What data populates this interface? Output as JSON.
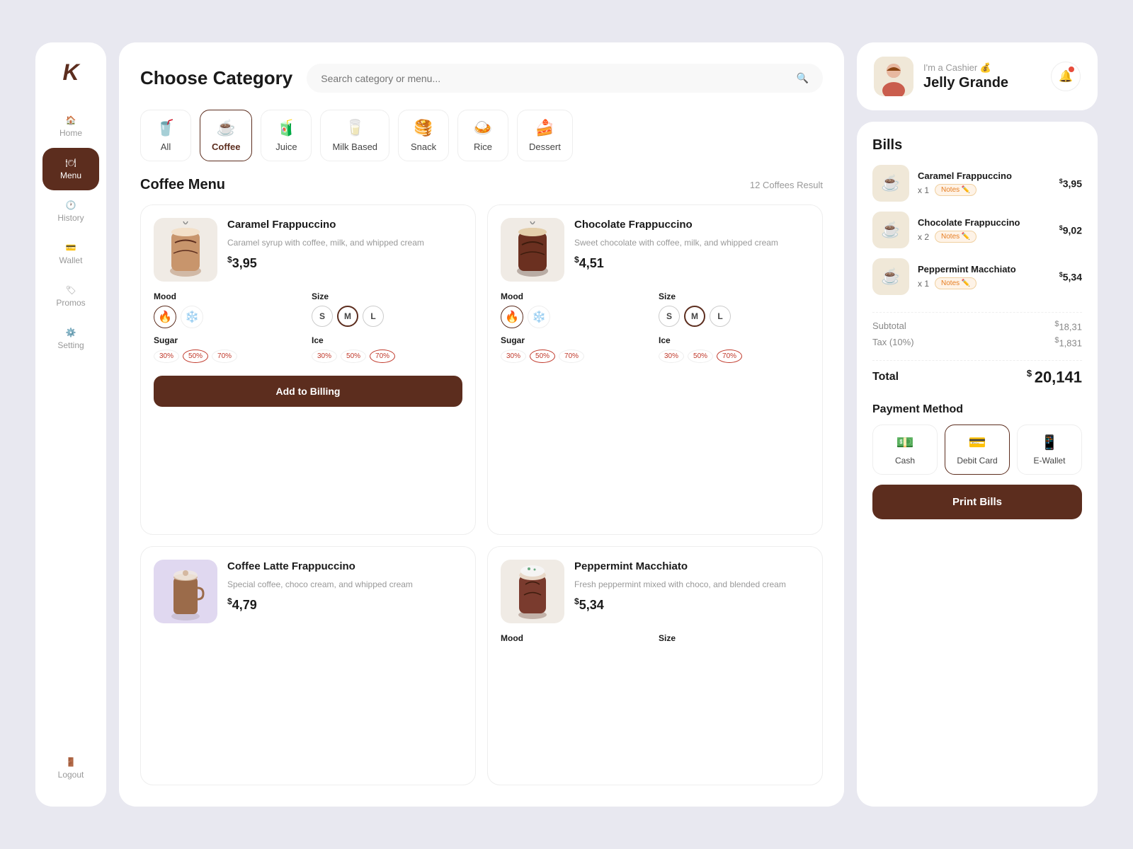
{
  "sidebar": {
    "logo": "K",
    "items": [
      {
        "id": "home",
        "label": "Home",
        "icon": "🏠",
        "active": false
      },
      {
        "id": "menu",
        "label": "Menu",
        "icon": "🍽",
        "active": true
      },
      {
        "id": "history",
        "label": "History",
        "icon": "🕐",
        "active": false
      },
      {
        "id": "wallet",
        "label": "Wallet",
        "icon": "💳",
        "active": false
      },
      {
        "id": "promos",
        "label": "Promos",
        "icon": "🏷",
        "active": false
      },
      {
        "id": "setting",
        "label": "Setting",
        "icon": "⚙️",
        "active": false
      }
    ],
    "logout_label": "Logout"
  },
  "header": {
    "title": "Choose Category",
    "search_placeholder": "Search category or menu..."
  },
  "categories": [
    {
      "id": "all",
      "label": "All",
      "emoji": "🥤",
      "active": false
    },
    {
      "id": "coffee",
      "label": "Coffee",
      "emoji": "☕",
      "active": true
    },
    {
      "id": "juice",
      "label": "Juice",
      "emoji": "🧃",
      "active": false
    },
    {
      "id": "milk_based",
      "label": "Milk Based",
      "emoji": "🥛",
      "active": false
    },
    {
      "id": "snack",
      "label": "Snack",
      "emoji": "🥞",
      "active": false
    },
    {
      "id": "rice",
      "label": "Rice",
      "emoji": "🍛",
      "active": false
    },
    {
      "id": "dessert",
      "label": "Dessert",
      "emoji": "🍰",
      "active": false
    }
  ],
  "menu": {
    "section_title": "Coffee Menu",
    "result_count": "12 Coffees Result",
    "add_billing_label": "Add to Billing",
    "items": [
      {
        "id": "caramel_frappuccino",
        "name": "Caramel Frappuccino",
        "description": "Caramel syrup with coffee, milk, and whipped cream",
        "price": "3,95",
        "currency": "$",
        "emoji": "🥤",
        "mood": {
          "hot": true,
          "cold": false
        },
        "sizes": [
          "S",
          "M",
          "L"
        ],
        "active_size": "M",
        "sugar": [
          "30%",
          "50%",
          "70%"
        ],
        "active_sugar": "50%",
        "ice": [
          "30%",
          "50%",
          "70%"
        ],
        "active_ice": "70%",
        "show_add_button": true
      },
      {
        "id": "chocolate_frappuccino",
        "name": "Chocolate Frappuccino",
        "description": "Sweet chocolate with coffee, milk, and whipped cream",
        "price": "4,51",
        "currency": "$",
        "emoji": "🥤",
        "mood": {
          "hot": true,
          "cold": false
        },
        "sizes": [
          "S",
          "M",
          "L"
        ],
        "active_size": "M",
        "sugar": [
          "30%",
          "50%",
          "70%"
        ],
        "active_sugar": "50%",
        "ice": [
          "30%",
          "50%",
          "70%"
        ],
        "active_ice": "70%",
        "show_add_button": false
      },
      {
        "id": "coffee_latte_frappuccino",
        "name": "Coffee Latte Frappuccino",
        "description": "Special coffee, choco cream, and whipped cream",
        "price": "4,79",
        "currency": "$",
        "emoji": "🥤",
        "show_add_button": false
      },
      {
        "id": "peppermint_macchiato",
        "name": "Peppermint Macchiato",
        "description": "Fresh peppermint mixed with choco, and blended cream",
        "price": "5,34",
        "currency": "$",
        "emoji": "🥤",
        "mood_label": "Mood",
        "size_label": "Size",
        "show_add_button": false
      }
    ]
  },
  "cashier": {
    "role": "I'm a Cashier 💰",
    "name": "Jelly Grande",
    "avatar_emoji": "👩"
  },
  "bills": {
    "title": "Bills",
    "items": [
      {
        "name": "Caramel Frappuccino",
        "qty": "x 1",
        "notes_label": "Notes ✏️",
        "price": "3,95",
        "currency": "$",
        "emoji": "☕"
      },
      {
        "name": "Chocolate Frappuccino",
        "qty": "x 2",
        "notes_label": "Notes ✏️",
        "price": "9,02",
        "currency": "$",
        "emoji": "☕"
      },
      {
        "name": "Peppermint Macchiato",
        "qty": "x 1",
        "notes_label": "Notes ✏️",
        "price": "5,34",
        "currency": "$",
        "emoji": "☕"
      }
    ],
    "subtotal_label": "Subtotal",
    "subtotal_value": "18,31",
    "tax_label": "Tax (10%)",
    "tax_value": "1,831",
    "total_label": "Total",
    "total_value": "20,141",
    "currency": "$"
  },
  "payment": {
    "title": "Payment Method",
    "methods": [
      {
        "id": "cash",
        "label": "Cash",
        "icon": "💵",
        "active": false
      },
      {
        "id": "debit_card",
        "label": "Debit Card",
        "icon": "💳",
        "active": true
      },
      {
        "id": "e_wallet",
        "label": "E-Wallet",
        "icon": "📱",
        "active": false
      }
    ],
    "print_bills_label": "Print Bills"
  }
}
